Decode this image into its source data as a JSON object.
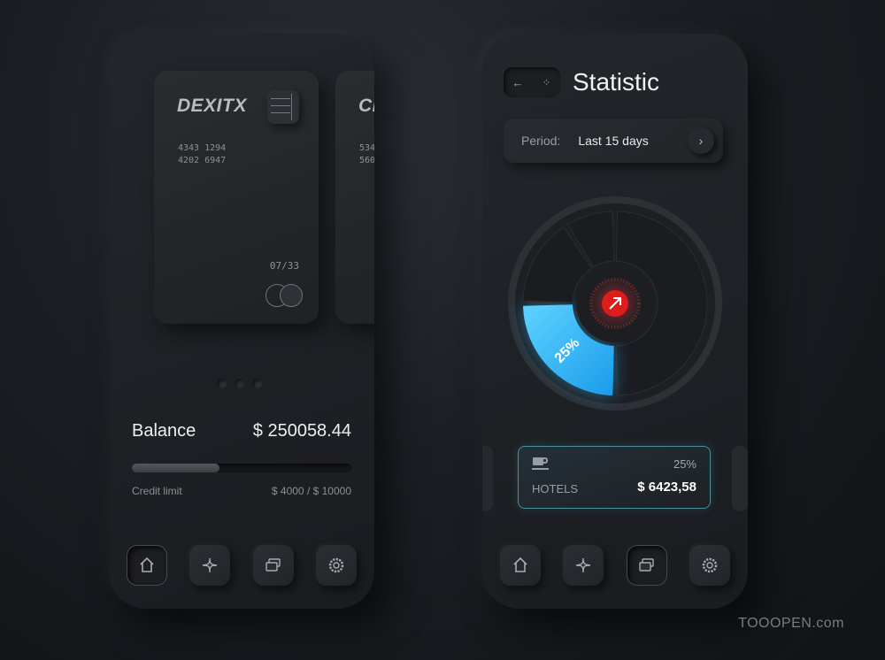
{
  "wallet": {
    "cards": [
      {
        "brand": "DEXITX",
        "number_line1": "4343 1294",
        "number_line2": "4202 6947",
        "expiry": "07/33"
      },
      {
        "brand": "CI",
        "number_line1": "534",
        "number_line2": "560"
      }
    ],
    "pager": {
      "count": 3,
      "active": 0
    },
    "balance_label": "Balance",
    "balance_value": "$ 250058.44",
    "credit_label": "Credit limit",
    "credit_value": "$ 4000 / $ 10000",
    "credit_fraction": 0.4,
    "nav": [
      "home-icon",
      "plus-icon",
      "cards-icon",
      "gear-icon"
    ],
    "nav_active": 0
  },
  "statistic": {
    "title": "Statistic",
    "back_icon": "arrow-left-icon",
    "grid_icon": "grid-icon",
    "period_label": "Period:",
    "period_value": "Last 15 days",
    "chart_data": {
      "type": "pie",
      "segments": [
        {
          "value": 50
        },
        {
          "value": 25,
          "label": "25%",
          "highlight": true,
          "color": "#33b7f5"
        },
        {
          "value": 16
        },
        {
          "value": 9
        }
      ]
    },
    "center_icon": "arrow-up-right-icon",
    "center_color": "#e01b1b",
    "category": {
      "icon": "cup-icon",
      "name": "HOTELS",
      "percent": "25%",
      "amount": "$ 6423,58"
    },
    "nav": [
      "home-icon",
      "plus-icon",
      "cards-icon",
      "gear-icon"
    ],
    "nav_active": 2
  },
  "watermark": "TOOOPEN.com"
}
